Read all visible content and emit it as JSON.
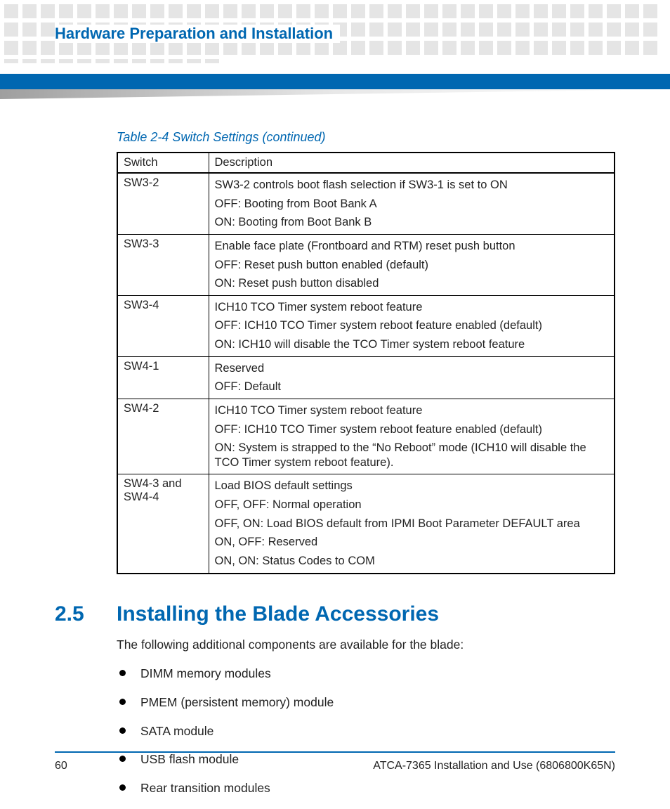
{
  "header": {
    "chapter_title": "Hardware Preparation and Installation"
  },
  "table": {
    "caption": "Table 2-4 Switch Settings  (continued)",
    "head": {
      "col1": "Switch",
      "col2": "Description"
    },
    "rows": [
      {
        "switch": "SW3-2",
        "desc": [
          "SW3-2 controls boot flash selection if SW3-1 is set to ON",
          "OFF: Booting from Boot Bank A",
          "ON: Booting from Boot Bank B"
        ]
      },
      {
        "switch": "SW3-3",
        "desc": [
          "Enable face plate (Frontboard and RTM) reset push button",
          "OFF: Reset push button enabled (default)",
          "ON: Reset push button disabled"
        ]
      },
      {
        "switch": "SW3-4",
        "desc": [
          "ICH10 TCO Timer system reboot feature",
          "OFF: ICH10 TCO Timer system reboot feature enabled (default)",
          "ON: ICH10 will disable the TCO Timer system reboot feature"
        ]
      },
      {
        "switch": "SW4-1",
        "desc": [
          "Reserved",
          "OFF: Default"
        ]
      },
      {
        "switch": "SW4-2",
        "desc": [
          "ICH10 TCO Timer system reboot feature",
          "OFF: ICH10 TCO Timer system reboot feature enabled (default)",
          "ON: System is strapped to the “No Reboot” mode (ICH10 will disable the TCO Timer system reboot feature)."
        ]
      },
      {
        "switch": "SW4-3 and SW4-4",
        "desc": [
          "Load BIOS default settings",
          "OFF, OFF: Normal operation",
          "OFF, ON: Load BIOS default from IPMI Boot Parameter DEFAULT area",
          "ON, OFF: Reserved",
          "ON, ON: Status Codes to COM"
        ]
      }
    ]
  },
  "section": {
    "number": "2.5",
    "title": "Installing the Blade Accessories",
    "intro": "The following additional components are available for the blade:",
    "items": [
      "DIMM memory modules",
      "PMEM (persistent memory) module",
      "SATA module",
      "USB flash module",
      "Rear transition modules"
    ]
  },
  "footer": {
    "page": "60",
    "doc": "ATCA-7365 Installation and Use (6806800K65N)"
  }
}
